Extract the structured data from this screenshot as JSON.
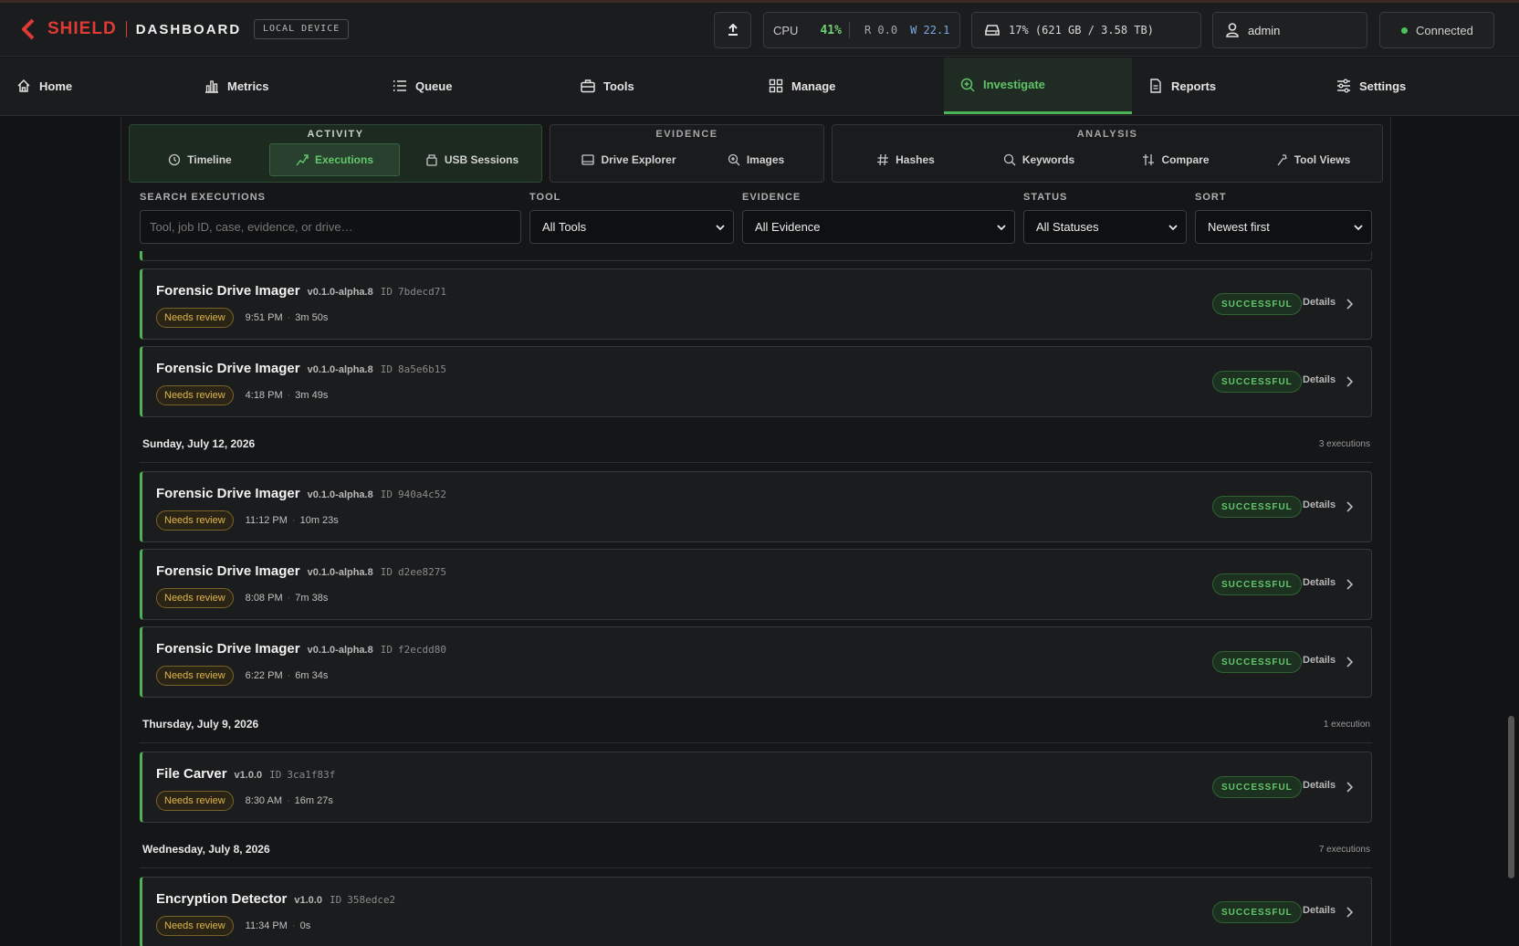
{
  "header": {
    "brand": "SHIELD",
    "product": "DASHBOARD",
    "device_badge": "LOCAL DEVICE",
    "cpu_label": "CPU",
    "cpu_value": "41%",
    "cpu_read": "R 0.0",
    "cpu_write": "W 22.1",
    "disk_text": "17% (621 GB / 3.58 TB)",
    "user": "admin",
    "connection": "Connected"
  },
  "nav": {
    "items": [
      {
        "label": "Home",
        "icon": "home-icon"
      },
      {
        "label": "Metrics",
        "icon": "bar-chart-icon"
      },
      {
        "label": "Queue",
        "icon": "list-icon"
      },
      {
        "label": "Tools",
        "icon": "toolbox-icon"
      },
      {
        "label": "Manage",
        "icon": "grid-icon"
      },
      {
        "label": "Investigate",
        "icon": "zoom-in-icon",
        "active": true
      },
      {
        "label": "Reports",
        "icon": "document-icon"
      },
      {
        "label": "Settings",
        "icon": "sliders-icon"
      }
    ]
  },
  "subnav": {
    "activity": {
      "title": "ACTIVITY",
      "items": [
        "Timeline",
        "Executions",
        "USB Sessions"
      ]
    },
    "evidence": {
      "title": "EVIDENCE",
      "items": [
        "Drive Explorer",
        "Images"
      ]
    },
    "analysis": {
      "title": "ANALYSIS",
      "items": [
        "Hashes",
        "Keywords",
        "Compare",
        "Tool Views"
      ]
    }
  },
  "filters": {
    "search_label": "SEARCH EXECUTIONS",
    "search_placeholder": "Tool, job ID, case, evidence, or drive…",
    "tool_label": "TOOL",
    "tool_value": "All Tools",
    "evidence_label": "EVIDENCE",
    "evidence_value": "All Evidence",
    "status_label": "STATUS",
    "status_value": "All Statuses",
    "sort_label": "SORT",
    "sort_value": "Newest first"
  },
  "common": {
    "review": "Needs review",
    "status": "SUCCESSFUL",
    "details": "Details",
    "id_label": "ID"
  },
  "groups": [
    {
      "executions": [
        {
          "tool": "Forensic Drive Imager",
          "version": "v0.1.0-alpha.8",
          "id": "7bdecd71",
          "time": "9:51 PM",
          "duration": "3m 50s"
        },
        {
          "tool": "Forensic Drive Imager",
          "version": "v0.1.0-alpha.8",
          "id": "8a5e6b15",
          "time": "4:18 PM",
          "duration": "3m 49s"
        }
      ]
    },
    {
      "date": "Sunday, July 12, 2026",
      "count": "3 executions",
      "executions": [
        {
          "tool": "Forensic Drive Imager",
          "version": "v0.1.0-alpha.8",
          "id": "940a4c52",
          "time": "11:12 PM",
          "duration": "10m 23s"
        },
        {
          "tool": "Forensic Drive Imager",
          "version": "v0.1.0-alpha.8",
          "id": "d2ee8275",
          "time": "8:08 PM",
          "duration": "7m 38s"
        },
        {
          "tool": "Forensic Drive Imager",
          "version": "v0.1.0-alpha.8",
          "id": "f2ecdd80",
          "time": "6:22 PM",
          "duration": "6m 34s"
        }
      ]
    },
    {
      "date": "Thursday, July 9, 2026",
      "count": "1 execution",
      "executions": [
        {
          "tool": "File Carver",
          "version": "v1.0.0",
          "id": "3ca1f83f",
          "time": "8:30 AM",
          "duration": "16m 27s"
        }
      ]
    },
    {
      "date": "Wednesday, July 8, 2026",
      "count": "7 executions",
      "executions": [
        {
          "tool": "Encryption Detector",
          "version": "v1.0.0",
          "id": "358edce2",
          "time": "11:34 PM",
          "duration": "0s"
        }
      ]
    }
  ],
  "colors": {
    "accent": "#4cb356",
    "brand": "#e03a36",
    "review": "#e0b64c"
  }
}
